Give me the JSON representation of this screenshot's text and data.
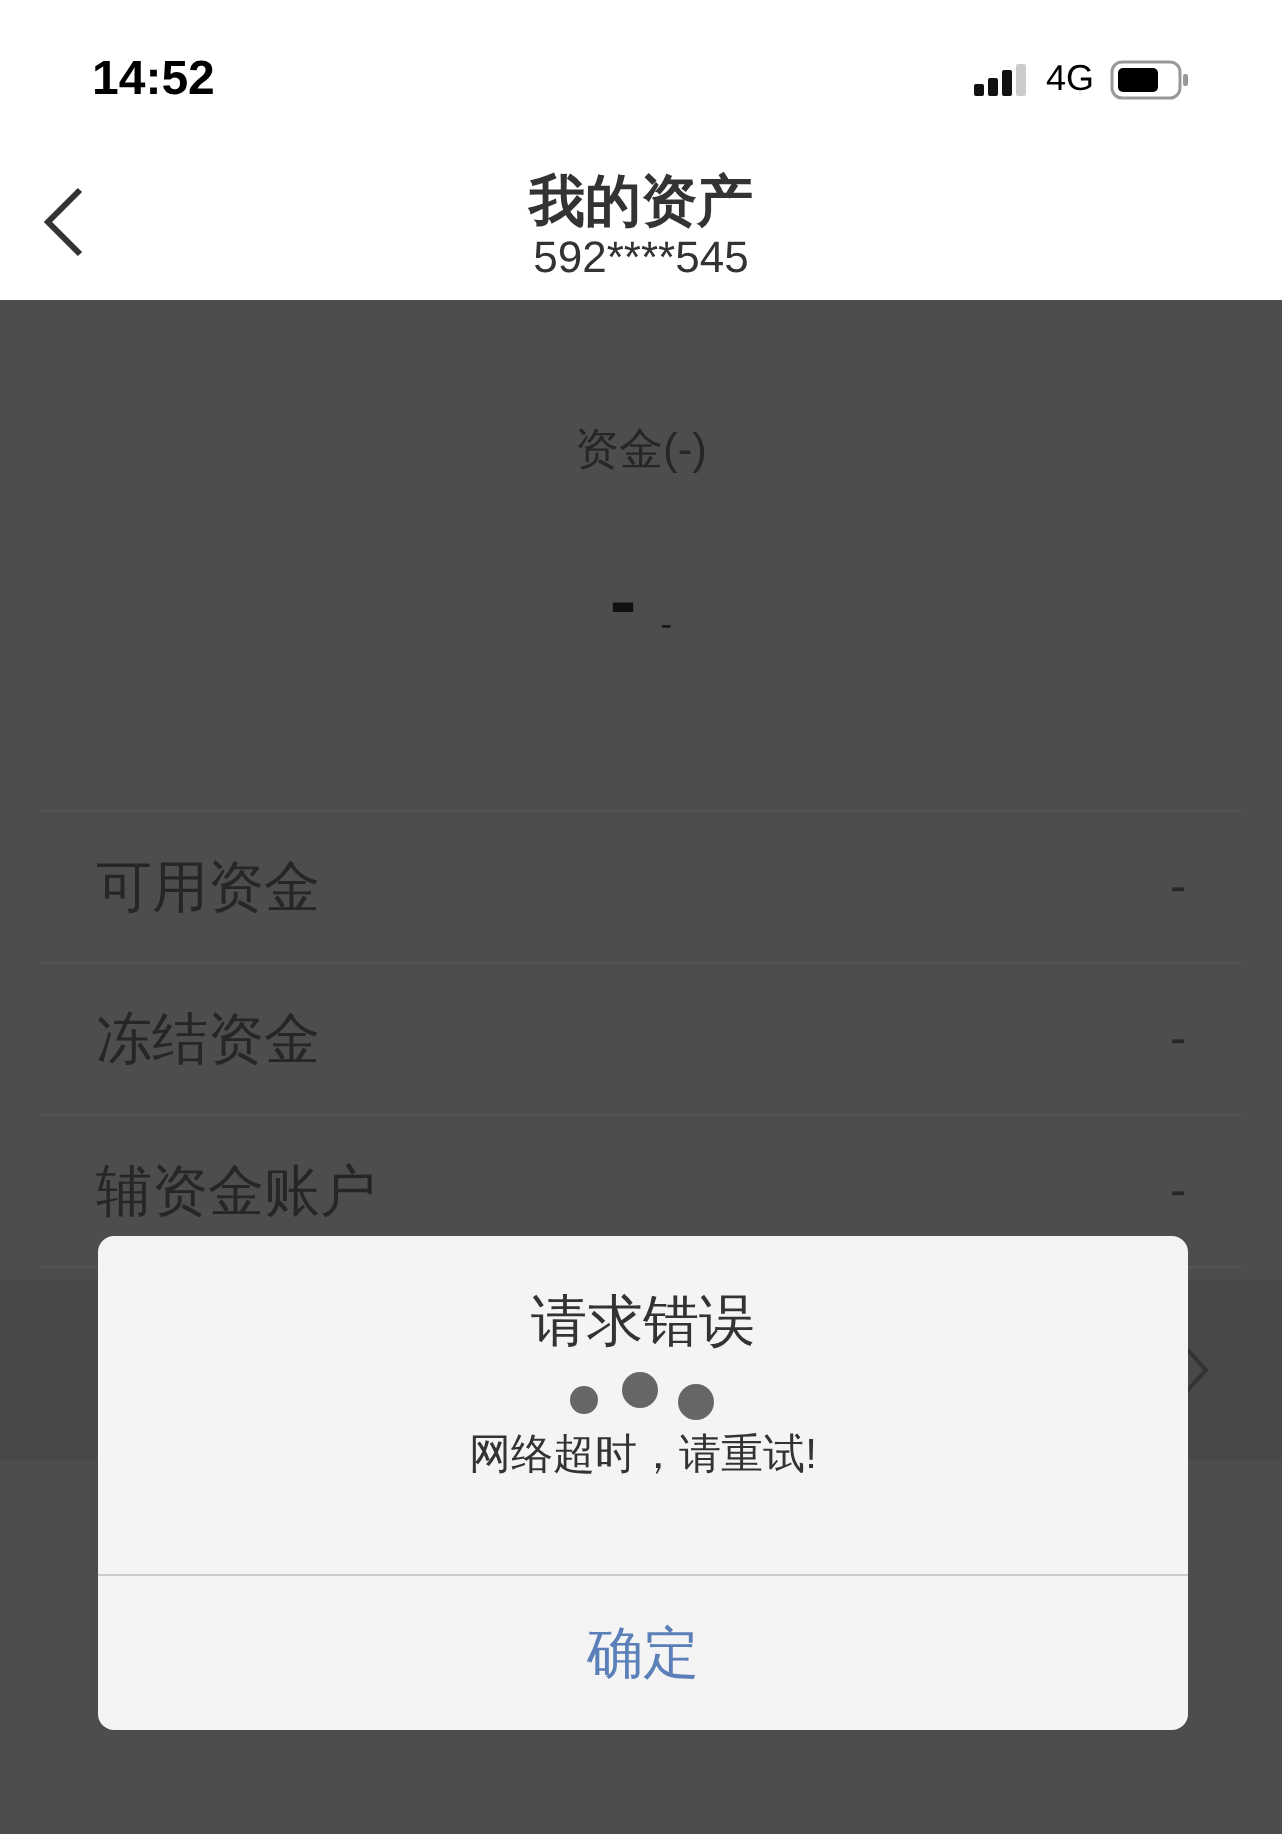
{
  "status_bar": {
    "time": "14:52",
    "network": "4G"
  },
  "nav": {
    "title": "我的资产",
    "subtitle": "592****545"
  },
  "summary": {
    "label": "资金(-)",
    "value": "-",
    "unit": "-"
  },
  "rows": [
    {
      "label": "可用资金",
      "value": "-"
    },
    {
      "label": "冻结资金",
      "value": "-"
    },
    {
      "label": "辅资金账户",
      "value": "-"
    }
  ],
  "dialog": {
    "title": "请求错误",
    "message": "网络超时，请重试!",
    "button": "确定"
  }
}
